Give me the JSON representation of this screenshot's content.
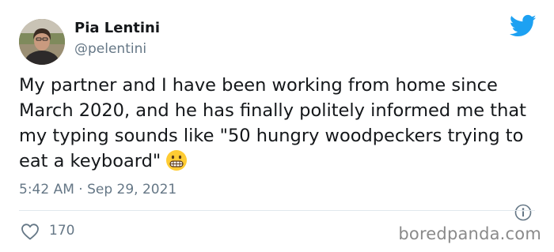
{
  "author": {
    "name": "Pia Lentini",
    "handle": "@pelentini"
  },
  "tweet": {
    "text": "My partner and I have been working from home since March 2020, and he has finally politely informed me that my typing sounds like \"50 hungry woodpeckers trying to eat a keyboard\"",
    "emoji": "grimacing-face-icon",
    "timestamp": "5:42 AM · Sep 29, 2021"
  },
  "engagement": {
    "likes": "170"
  },
  "watermark": "boredpanda.com",
  "colors": {
    "twitter_blue": "#1da1f2",
    "secondary_text": "#657786",
    "primary_text": "#14171a"
  }
}
